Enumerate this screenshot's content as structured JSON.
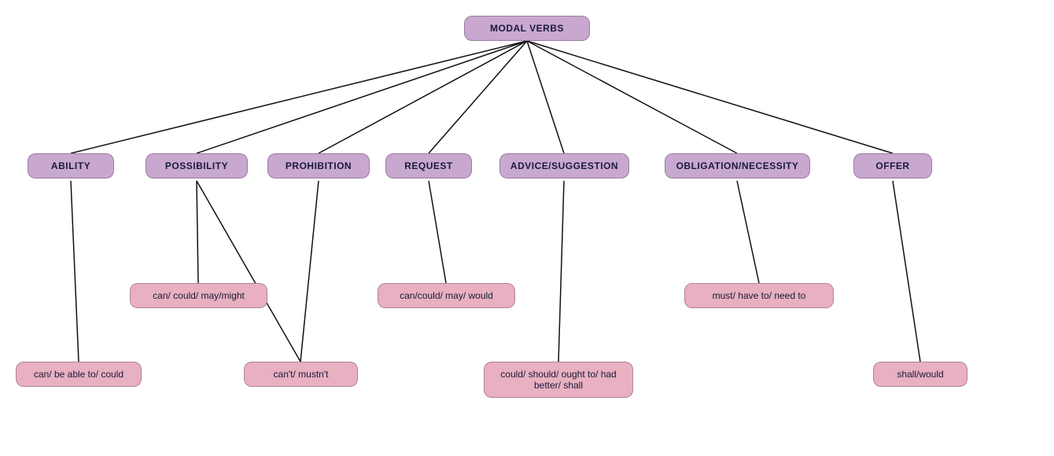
{
  "nodes": {
    "root": {
      "label": "MODAL VERBS"
    },
    "ability": {
      "label": "ABILITY"
    },
    "possibility": {
      "label": "POSSIBILITY"
    },
    "prohibition": {
      "label": "PROHIBITION"
    },
    "request": {
      "label": "REQUEST"
    },
    "advice": {
      "label": "ADVICE/SUGGESTION"
    },
    "obligation": {
      "label": "OBLIGATION/NECESSITY"
    },
    "offer": {
      "label": "OFFER"
    },
    "can_able": {
      "label": "can/ be able to/ could"
    },
    "can_could_may": {
      "label": "can/ could/ may/might"
    },
    "cant_mustnt": {
      "label": "can't/ mustn't"
    },
    "can_could_would": {
      "label": "can/could/ may/ would"
    },
    "could_should": {
      "label": "could/ should/ ought to/ had better/ shall"
    },
    "must_have": {
      "label": "must/ have to/ need to"
    },
    "shall_would": {
      "label": "shall/would"
    }
  }
}
